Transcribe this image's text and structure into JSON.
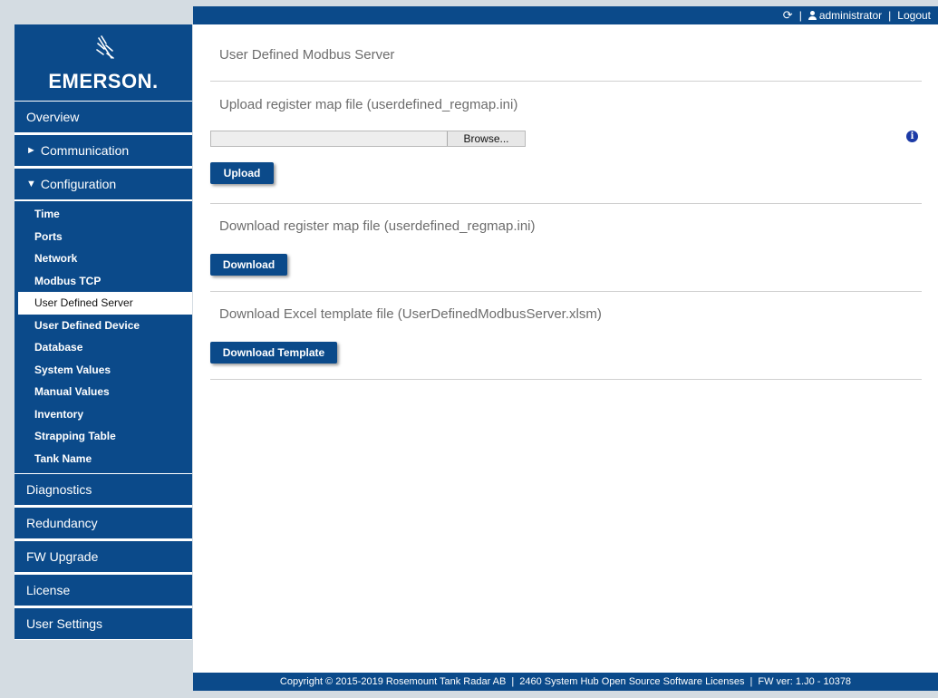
{
  "userbar": {
    "refresh_icon": "refresh-icon",
    "user_icon": "user-icon",
    "separator": "|",
    "username": "administrator",
    "logout_label": "Logout"
  },
  "logo": {
    "wordmark": "EMERSON."
  },
  "sidebar": {
    "overview": "Overview",
    "communication": "Communication",
    "configuration": "Configuration",
    "config_items": [
      "Time",
      "Ports",
      "Network",
      "Modbus TCP",
      "User Defined Server",
      "User Defined Device",
      "Database",
      "System Values",
      "Manual Values",
      "Inventory",
      "Strapping Table",
      "Tank Name"
    ],
    "diagnostics": "Diagnostics",
    "redundancy": "Redundancy",
    "fw_upgrade": "FW Upgrade",
    "license": "License",
    "user_settings": "User Settings"
  },
  "main": {
    "page_title": "User Defined Modbus Server",
    "upload_title": "Upload register map file (userdefined_regmap.ini)",
    "browse_label": "Browse...",
    "info_glyph": "i",
    "upload_label": "Upload",
    "download_title": "Download register map file (userdefined_regmap.ini)",
    "download_label": "Download",
    "template_title": "Download Excel template file (UserDefinedModbusServer.xlsm)",
    "template_label": "Download Template"
  },
  "footer": {
    "copyright": "Copyright © 2015-2019 Rosemount Tank Radar AB",
    "separator": "|",
    "licenses_link": "2460 System Hub Open Source Software Licenses",
    "fw_version": "FW ver: 1.J0 - 10378"
  },
  "colors": {
    "brand_blue": "#0b4a8a",
    "background": "#d4dce2",
    "info_blue": "#1c3aa6"
  }
}
